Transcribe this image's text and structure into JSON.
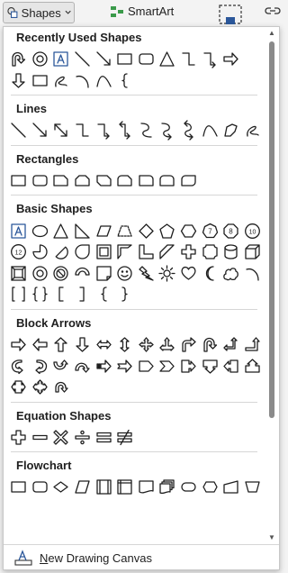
{
  "ribbon": {
    "shapes_label": "Shapes",
    "smartart_label": "SmartArt"
  },
  "sections": [
    {
      "title": "Recently Used Shapes",
      "rows": [
        [
          "u-turn-arrow",
          "donut",
          "text-box",
          "line",
          "arrow-line",
          "rectangle",
          "rounded-rectangle",
          "triangle",
          "elbow-connector",
          "elbow-arrow-connector",
          "right-arrow"
        ],
        [
          "down-arrow",
          "snip-corner",
          "freeform-scribble",
          "arc",
          "curve",
          "left-brace"
        ]
      ]
    },
    {
      "title": "Lines",
      "rows": [
        [
          "line",
          "arrow-line",
          "double-arrow-line",
          "elbow-connector",
          "elbow-arrow-connector",
          "elbow-double-arrow",
          "curved-connector",
          "curved-arrow-connector",
          "curved-double-arrow",
          "curve",
          "freeform",
          "scribble"
        ]
      ]
    },
    {
      "title": "Rectangles",
      "rows": [
        [
          "rectangle",
          "rounded-rectangle",
          "snip-single-corner",
          "snip-same-side",
          "snip-diagonal",
          "snip-round-single",
          "round-single-corner",
          "round-same-side",
          "round-diagonal"
        ]
      ]
    },
    {
      "title": "Basic Shapes",
      "rows": [
        [
          "text-box",
          "oval",
          "triangle",
          "right-triangle",
          "parallelogram",
          "trapezoid",
          "diamond",
          "pentagon",
          "hexagon",
          "heptagon-7",
          "octagon-8",
          "decagon-10"
        ],
        [
          "dodecagon-12",
          "pie",
          "chord",
          "teardrop",
          "frame",
          "half-frame",
          "l-shape",
          "diagonal-stripe",
          "cross",
          "plaque",
          "can",
          "cube"
        ],
        [
          "bevel",
          "donut",
          "no-symbol",
          "block-arc",
          "folded-corner",
          "smiley-face",
          "lightning-bolt",
          "sun",
          "heart",
          "moon",
          "cloud",
          "arc"
        ],
        [
          "double-bracket",
          "double-brace",
          "left-bracket",
          "right-bracket",
          "left-brace",
          "right-brace"
        ]
      ]
    },
    {
      "title": "Block Arrows",
      "rows": [
        [
          "right-arrow",
          "left-arrow",
          "up-arrow",
          "down-arrow",
          "left-right-arrow",
          "up-down-arrow",
          "quad-arrow",
          "left-right-up-arrow",
          "bent-arrow",
          "u-turn-arrow",
          "left-up-arrow",
          "bent-up-arrow"
        ],
        [
          "curved-right-arrow",
          "curved-left-arrow",
          "curved-up-arrow",
          "curved-down-arrow",
          "striped-right-arrow",
          "notched-right-arrow",
          "pentagon-arrow",
          "chevron",
          "right-arrow-callout",
          "down-arrow-callout",
          "left-arrow-callout",
          "up-arrow-callout"
        ],
        [
          "left-right-arrow-callout",
          "quad-arrow-callout",
          "circular-arrow"
        ]
      ]
    },
    {
      "title": "Equation Shapes",
      "rows": [
        [
          "plus",
          "minus",
          "multiply",
          "division",
          "equal",
          "not-equal"
        ]
      ]
    },
    {
      "title": "Flowchart",
      "rows": [
        [
          "process",
          "alternate-process",
          "decision",
          "data",
          "predefined-process",
          "internal-storage",
          "document",
          "multidocument",
          "terminator",
          "preparation",
          "manual-input",
          "manual-operation"
        ]
      ]
    }
  ],
  "footer": {
    "new_canvas_label_u": "N",
    "new_canvas_label_rest": "ew Drawing Canvas"
  }
}
